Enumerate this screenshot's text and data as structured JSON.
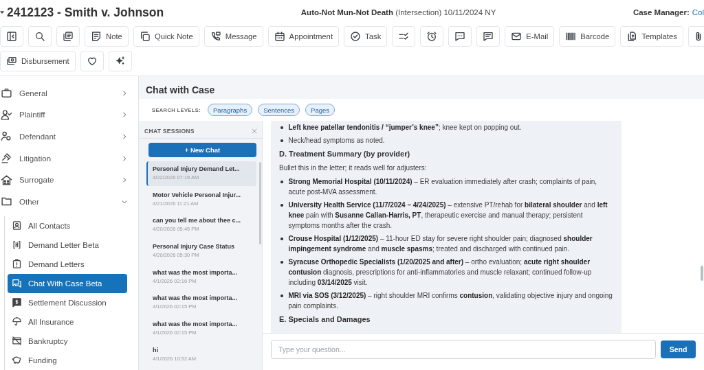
{
  "header": {
    "case_title": "2412123 - Smith v. Johnson",
    "case_info": "**Auto-Not Mun-Not Death** (Intersection) 10/11/2024 NY",
    "case_manager": {
      "label": "Case Manager:",
      "value": "Col"
    }
  },
  "toolbar": {
    "rows": [
      [
        {
          "kind": "icon"
        },
        {
          "kind": "icon"
        },
        {
          "kind": "icon"
        },
        {
          "kind": "labeled",
          "label": "Note"
        },
        {
          "kind": "labeled",
          "label": "Quick Note"
        },
        {
          "kind": "labeled",
          "label": "Message"
        },
        {
          "kind": "labeled",
          "label": "Appointment"
        },
        {
          "kind": "labeled",
          "label": "Task"
        },
        {
          "kind": "icon"
        },
        {
          "kind": "icon"
        },
        {
          "kind": "icon"
        },
        {
          "kind": "icon"
        },
        {
          "kind": "labeled",
          "label": "E-Mail"
        },
        {
          "kind": "labeled",
          "label": "Barcode"
        },
        {
          "kind": "labeled",
          "label": "Templates"
        },
        {
          "kind": "icon"
        }
      ],
      [
        {
          "kind": "labeled",
          "label": "Disbursement"
        },
        {
          "kind": "icon"
        },
        {
          "kind": "icon"
        }
      ]
    ]
  },
  "sidebar": {
    "items": [
      {
        "label": "General",
        "expanded": false
      },
      {
        "label": "Plaintiff",
        "expanded": false
      },
      {
        "label": "Defendant",
        "expanded": false
      },
      {
        "label": "Litigation",
        "expanded": false
      },
      {
        "label": "Surrogate",
        "expanded": false
      },
      {
        "label": "Other",
        "expanded": true,
        "children": [
          {
            "label": "All Contacts",
            "selected": false
          },
          {
            "label": "Demand Letter Beta",
            "selected": false
          },
          {
            "label": "Demand Letters",
            "selected": false
          },
          {
            "label": "Chat With Case Beta",
            "selected": true
          },
          {
            "label": "Settlement Discussion",
            "selected": false
          },
          {
            "label": "All Insurance",
            "selected": false
          },
          {
            "label": "Bankruptcy",
            "selected": false
          },
          {
            "label": "Funding",
            "selected": false
          }
        ]
      }
    ]
  },
  "chat": {
    "title": "Chat with Case",
    "search_levels": {
      "label": "SEARCH LEVELS:",
      "options": [
        {
          "label": "Paragraphs",
          "selected": false
        },
        {
          "label": "Sentences",
          "selected": false
        },
        {
          "label": "Pages",
          "selected": false
        }
      ]
    },
    "sessions_panel": {
      "title": "CHAT SESSIONS",
      "new_chat": "+ New Chat",
      "sessions": [
        {
          "title": "Personal Injury Demand Let...",
          "date": "4/22/2026 07:19 AM",
          "selected": true
        },
        {
          "title": "Motor Vehicle Personal Injur...",
          "date": "4/21/2026 11:21 AM",
          "selected": false
        },
        {
          "title": "can you tell me about thee c...",
          "date": "4/20/2026 05:45 PM",
          "selected": false
        },
        {
          "title": "Personal Injury Case Status",
          "date": "4/20/2026 05:30 PM",
          "selected": false
        },
        {
          "title": "what was the most importa...",
          "date": "4/1/2026 02:16 PM",
          "selected": false
        },
        {
          "title": "what was the most importa...",
          "date": "4/1/2026 02:15 PM",
          "selected": false
        },
        {
          "title": "what was the most importa...",
          "date": "4/1/2026 02:15 PM",
          "selected": false
        },
        {
          "title": "hi",
          "date": "4/1/2026 10:52 AM",
          "selected": false
        }
      ]
    },
    "message": {
      "blocks": [
        {
          "kind": "bullets",
          "items": [
            "**Left knee patellar tendonitis / “jumper’s knee”**; knee kept on popping out.",
            "Neck/head symptoms as noted."
          ]
        },
        {
          "kind": "heading",
          "text": "D. Treatment Summary (by provider)"
        },
        {
          "kind": "paragraph",
          "text": "Bullet this in the letter; it reads well for adjusters:"
        },
        {
          "kind": "bullets",
          "items": [
            "**Strong Memorial Hospital (10/11/2024)** – ER evaluation immediately after crash; complaints of pain, acute post-MVA assessment.",
            "**University Health Service (11/7/2024 – 4/24/2025)** – extensive PT/rehab for **bilateral shoulder** and **left knee** pain with **Susanne Callan-Harris, PT**, therapeutic exercise and manual therapy; persistent symptoms months after the crash.",
            "**Crouse Hospital (1/12/2025)** – 11-hour ED stay for severe right shoulder pain; diagnosed **shoulder impingement syndrome** and **muscle spasms**; treated and discharged with continued pain.",
            "**Syracuse Orthopedic Specialists (1/20/2025 and after)** – ortho evaluation; **acute right shoulder contusion** diagnosis, prescriptions for anti-inflammatories and muscle relaxant; continued follow-up including **03/14/2025** visit.",
            "**MRI via SOS (3/12/2025)** – right shoulder MRI confirms **contusion**, validating objective injury and ongoing pain complaints."
          ]
        },
        {
          "kind": "heading",
          "text": "E. Specials and Damages"
        }
      ]
    },
    "composer": {
      "placeholder": "Type your question...",
      "send": "Send"
    }
  }
}
